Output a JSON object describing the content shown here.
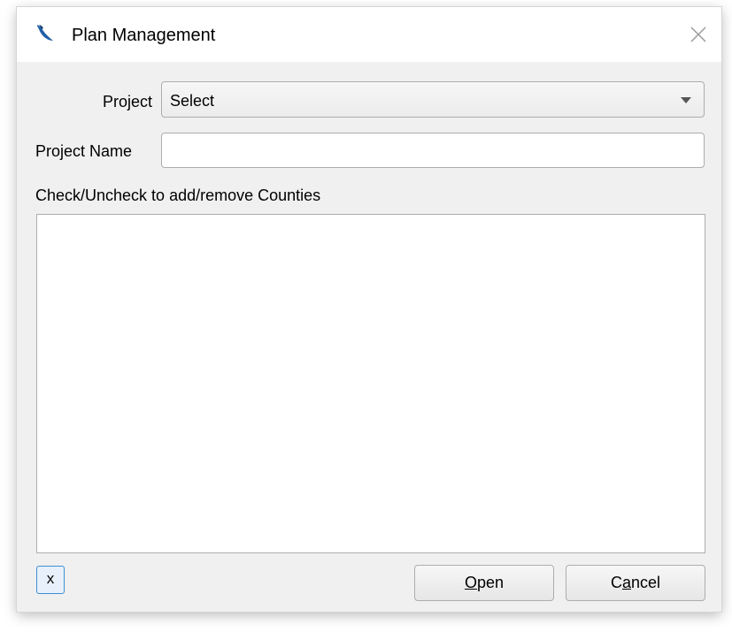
{
  "window": {
    "title": "Plan Management",
    "app_icon": "bird-feather-icon",
    "close_icon": "close-icon"
  },
  "form": {
    "project_label": "Project",
    "project_select_value": "Select",
    "project_name_label": "Project Name",
    "project_name_value": "",
    "counties_instruction": "Check/Uncheck to add/remove Counties",
    "counties": []
  },
  "footer": {
    "x_label": "x",
    "open_mnemonic": "O",
    "open_rest": "pen",
    "cancel_pre": "C",
    "cancel_mnemonic": "a",
    "cancel_rest": "ncel"
  },
  "colors": {
    "dialog_bg": "#f0f0f0",
    "title_bg": "#ffffff",
    "accent": "#1f5fa8",
    "focus_border": "#3d8fd6"
  }
}
